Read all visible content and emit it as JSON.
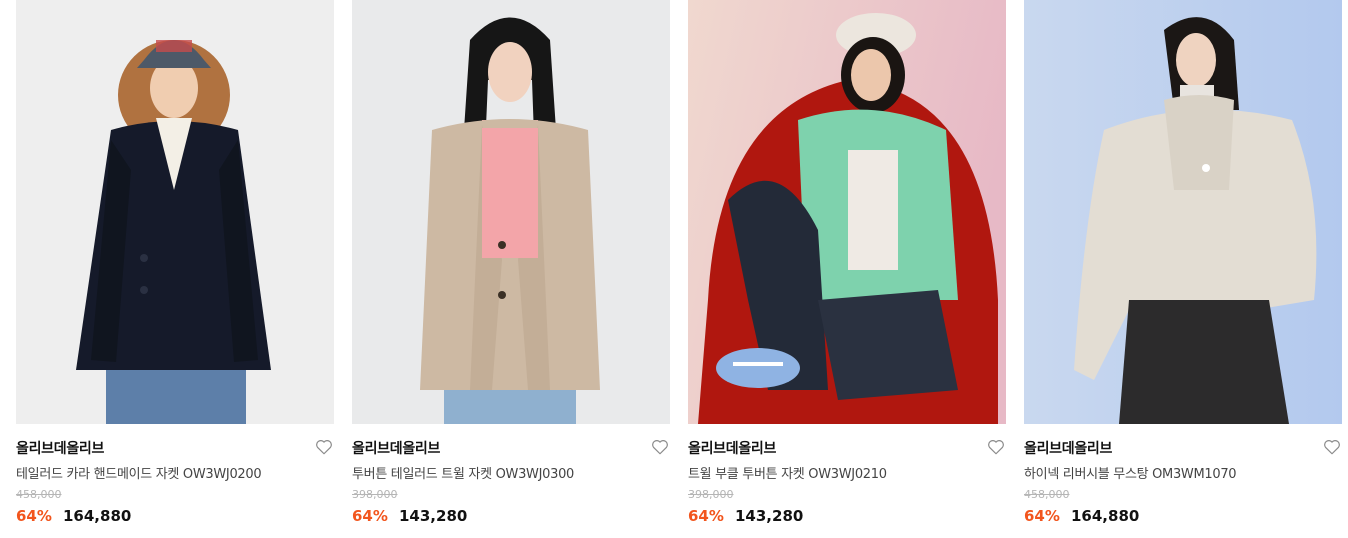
{
  "products": [
    {
      "brand": "올리브데올리브",
      "name": "테일러드 카라 핸드메이드 자켓 OW3WJ0200",
      "original_price": "458,000",
      "discount": "64%",
      "sale_price": "164,880",
      "image_alt": "model-navy-double-breasted-jacket"
    },
    {
      "brand": "올리브데올리브",
      "name": "투버튼 테일러드 트윌 자켓 OW3WJ0300",
      "original_price": "398,000",
      "discount": "64%",
      "sale_price": "143,280",
      "image_alt": "model-beige-tailored-jacket"
    },
    {
      "brand": "올리브데올리브",
      "name": "트윌 부클 투버튼 자켓 OW3WJ0210",
      "original_price": "398,000",
      "discount": "64%",
      "sale_price": "143,280",
      "image_alt": "model-green-boucle-jacket"
    },
    {
      "brand": "올리브데올리브",
      "name": "하이넥 리버시블 무스탕 OM3WM1070",
      "original_price": "458,000",
      "discount": "64%",
      "sale_price": "164,880",
      "image_alt": "model-ivory-shearling-coat"
    }
  ],
  "colors": {
    "discount": "#f2551d",
    "strikethrough": "#b5b5b5",
    "accent_bg_3": "#e8c9c6",
    "accent_bg_4": "#bcd0ee"
  },
  "icons": {
    "like": "heart-outline-icon"
  }
}
